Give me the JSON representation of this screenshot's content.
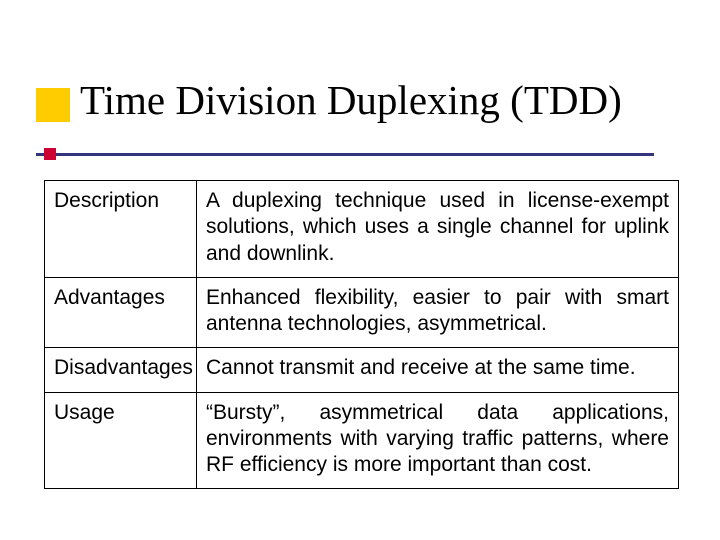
{
  "title": "Time Division Duplexing (TDD)",
  "rows": [
    {
      "label": "Description",
      "value": "A duplexing technique used in license-exempt solutions, which uses a single channel for uplink and downlink."
    },
    {
      "label": "Advantages",
      "value": "Enhanced flexibility, easier to pair with smart antenna technologies, asymmetrical."
    },
    {
      "label": "Disadvantages",
      "value": "Cannot transmit and receive at the same time."
    },
    {
      "label": "Usage",
      "value": "“Bursty”, asymmetrical data applications, environments with varying traffic patterns, where RF efficiency is more important than cost."
    }
  ]
}
